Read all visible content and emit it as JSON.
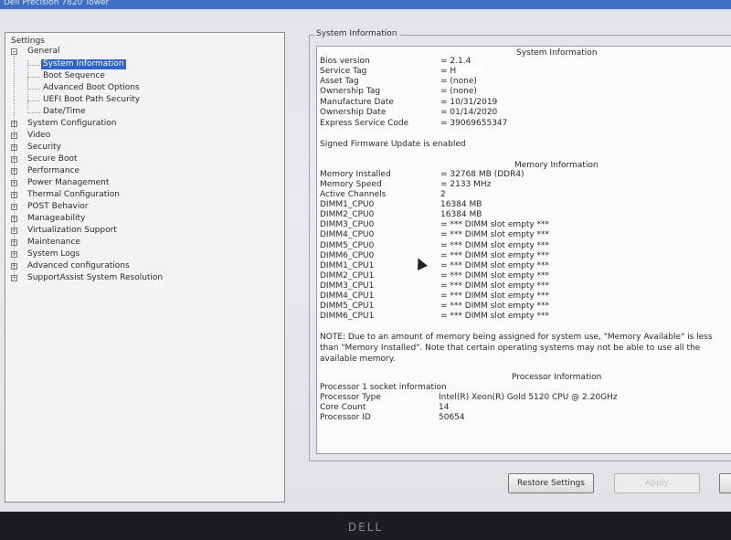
{
  "window": {
    "title": "Dell Precision 7820 Tower"
  },
  "tree": {
    "root": "Settings",
    "general": {
      "label": "General",
      "children": [
        "System Information",
        "Boot Sequence",
        "Advanced Boot Options",
        "UEFI Boot Path Security",
        "Date/Time"
      ]
    },
    "groups": [
      "System Configuration",
      "Video",
      "Security",
      "Secure Boot",
      "Performance",
      "Power Management",
      "Thermal Configuration",
      "POST Behavior",
      "Manageability",
      "Virtualization Support",
      "Maintenance",
      "System Logs",
      "Advanced configurations",
      "SupportAssist System Resolution"
    ]
  },
  "info": {
    "group_label": "System Information",
    "section_system": "System Information",
    "system_rows": [
      {
        "label": "Bios version",
        "value": "= 2.1.4"
      },
      {
        "label": "Service Tag",
        "value": "= H        03"
      },
      {
        "label": "Asset Tag",
        "value": "= (none)"
      },
      {
        "label": "Ownership Tag",
        "value": "= (none)"
      },
      {
        "label": "Manufacture Date",
        "value": "= 10/31/2019"
      },
      {
        "label": "Ownership Date",
        "value": "= 01/14/2020"
      },
      {
        "label": "Express Service Code",
        "value": "= 39069655347"
      }
    ],
    "firmware_note": "Signed Firmware Update is enabled",
    "section_memory": "Memory Information",
    "memory_rows": [
      {
        "label": "Memory Installed",
        "value": "= 32768 MB (DDR4)"
      },
      {
        "label": "Memory Speed",
        "value": "= 2133 MHz"
      },
      {
        "label": "Active Channels",
        "value": "2"
      },
      {
        "label": "DIMM1_CPU0",
        "value": "16384 MB"
      },
      {
        "label": "DIMM2_CPU0",
        "value": "16384 MB"
      },
      {
        "label": "DIMM3_CPU0",
        "value": "= *** DIMM slot empty ***"
      },
      {
        "label": "DIMM4_CPU0",
        "value": "= *** DIMM slot empty ***"
      },
      {
        "label": "DIMM5_CPU0",
        "value": "= *** DIMM slot empty ***"
      },
      {
        "label": "DIMM6_CPU0",
        "value": "= *** DIMM slot empty ***"
      },
      {
        "label": "DIMM1_CPU1",
        "value": "= *** DIMM slot empty ***"
      },
      {
        "label": "DIMM2_CPU1",
        "value": "= *** DIMM slot empty ***"
      },
      {
        "label": "DIMM3_CPU1",
        "value": "= *** DIMM slot empty ***"
      },
      {
        "label": "DIMM4_CPU1",
        "value": "= *** DIMM slot empty ***"
      },
      {
        "label": "DIMM5_CPU1",
        "value": "= *** DIMM slot empty ***"
      },
      {
        "label": "DIMM6_CPU1",
        "value": "= *** DIMM slot empty ***"
      }
    ],
    "note_lines": [
      "NOTE: Due to an amount of memory being assigned for system use, \"Memory Available\" is less",
      "than \"Memory Installed\". Note that certain operating systems may not be able to use all the",
      "available memory."
    ],
    "section_processor": "Processor Information",
    "processor_socket": "Processor 1 socket information",
    "processor_rows": [
      {
        "label": "Processor Type",
        "value": "Intel(R) Xeon(R) Gold 5120 CPU @ 2.20GHz"
      },
      {
        "label": "Core Count",
        "value": "14"
      },
      {
        "label": "Processor ID",
        "value": "50654"
      }
    ]
  },
  "buttons": {
    "restore": "Restore Settings",
    "apply": "Apply"
  },
  "bezel": {
    "logo": "DELL"
  },
  "colors": {
    "selection": "#2f63c9",
    "titlebar": "#3e6fc2"
  }
}
